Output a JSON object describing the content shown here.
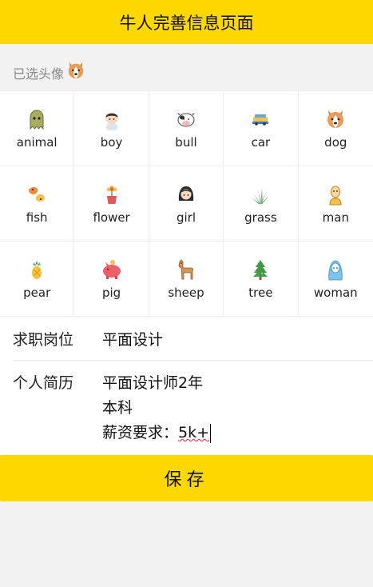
{
  "header": {
    "title": "牛人完善信息页面"
  },
  "selected": {
    "label": "已选头像",
    "avatar": "dog"
  },
  "avatars": [
    {
      "label": "animal"
    },
    {
      "label": "boy"
    },
    {
      "label": "bull"
    },
    {
      "label": "car"
    },
    {
      "label": "dog"
    },
    {
      "label": "fish"
    },
    {
      "label": "flower"
    },
    {
      "label": "girl"
    },
    {
      "label": "grass"
    },
    {
      "label": "man"
    },
    {
      "label": "pear"
    },
    {
      "label": "pig"
    },
    {
      "label": "sheep"
    },
    {
      "label": "tree"
    },
    {
      "label": "woman"
    }
  ],
  "form": {
    "job_label": "求职岗位",
    "job_value": "平面设计",
    "resume_label": "个人简历",
    "resume_line1": "平面设计师2年",
    "resume_line2": "本科",
    "resume_line3_prefix": "薪资要求：",
    "resume_line3_value": "5k+"
  },
  "save_label": "保存"
}
